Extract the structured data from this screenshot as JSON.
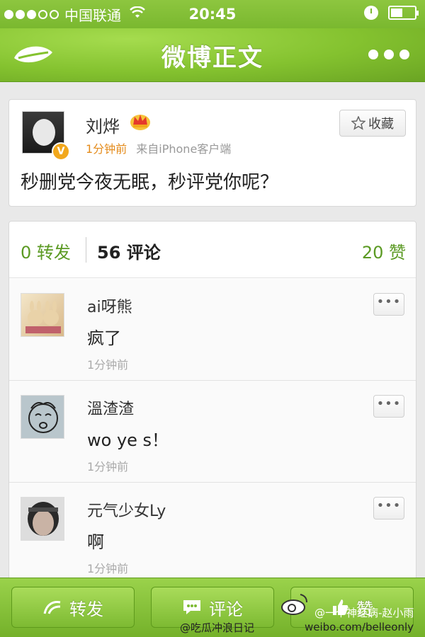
{
  "status_bar": {
    "carrier": "中国联通",
    "time": "20:45",
    "signal_bars_filled": 3,
    "signal_bars_total": 5
  },
  "nav": {
    "title": "微博正文",
    "logo_icon": "weibo-leaf-icon",
    "more_icon": "more-dots-icon"
  },
  "post": {
    "author": "刘烨",
    "time_ago": "1分钟前",
    "source": "来自iPhone客户端",
    "favorite_label": "收藏",
    "text": "秒删党今夜无眠，秒评党你呢？",
    "verified_label": "V"
  },
  "stats": {
    "reposts": "0 转发",
    "comments": "56 评论",
    "likes": "20 赞"
  },
  "comments": [
    {
      "name": "ai呀熊",
      "text": "疯了",
      "time": "1分钟前"
    },
    {
      "name": "溫渣渣",
      "text": "wo ye s！",
      "time": "1分钟前"
    },
    {
      "name": "元气少女Ly",
      "text": "啊",
      "time": "1分钟前"
    }
  ],
  "comment_more_label": "•••",
  "toolbar": {
    "repost": "转发",
    "comment": "评论",
    "like": "赞"
  },
  "watermarks": {
    "account": "@吃瓜冲浪日记",
    "credit": "@一个神经病-赵小雨",
    "url": "weibo.com/belleonly"
  },
  "colors": {
    "brand_green": "#84c22f",
    "link_green": "#5b9a23",
    "orange": "#e48b1b"
  }
}
